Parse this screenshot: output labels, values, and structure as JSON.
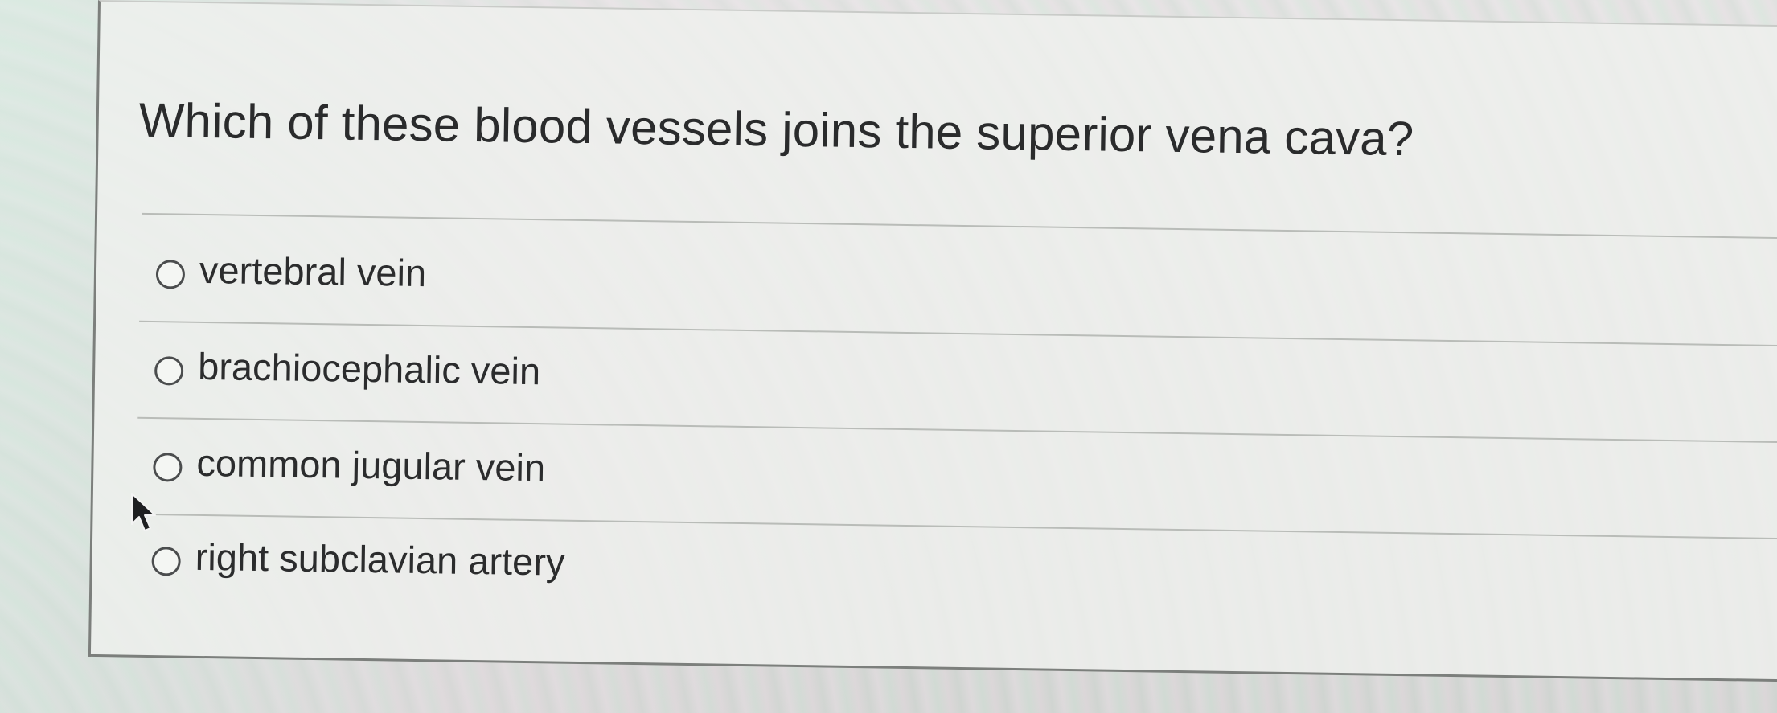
{
  "question": {
    "text": "Which of these blood vessels joins the superior vena cava?"
  },
  "answers": [
    {
      "label": "vertebral vein",
      "selected": false
    },
    {
      "label": "brachiocephalic vein",
      "selected": false
    },
    {
      "label": "common jugular vein",
      "selected": false
    },
    {
      "label": "right subclavian artery",
      "selected": false
    }
  ],
  "icons": {
    "cursor": "mouse-pointer-icon",
    "radio": "radio-button-unselected"
  }
}
